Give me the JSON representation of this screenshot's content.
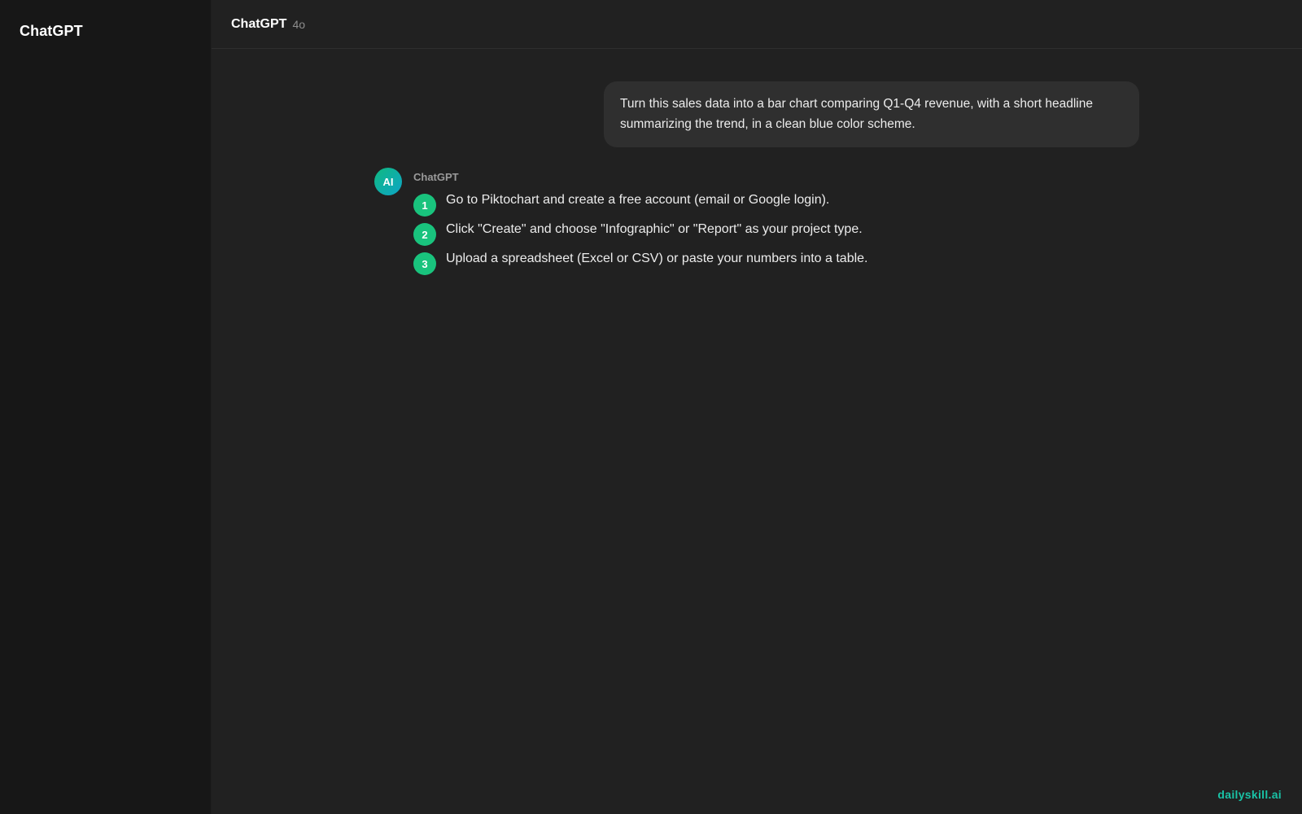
{
  "sidebar": {
    "title": "ChatGPT"
  },
  "header": {
    "title": "ChatGPT",
    "model": "4o"
  },
  "conversation": {
    "user_message": "Turn this sales data into a bar chart comparing Q1-Q4 revenue, with a short headline summarizing the trend, in a clean blue color scheme.",
    "assistant": {
      "avatar_label": "AI",
      "name": "ChatGPT",
      "steps": [
        {
          "number": "1",
          "text": "Go to Piktochart and create a free account (email or Google login)."
        },
        {
          "number": "2",
          "text": "Click \"Create\" and choose \"Infographic\" or \"Report\" as your project type."
        },
        {
          "number": "3",
          "text": "Upload a spreadsheet (Excel or CSV) or paste your numbers into a table."
        }
      ]
    }
  },
  "watermark": "dailyskill.ai",
  "colors": {
    "sidebar_bg": "#171717",
    "main_bg": "#212121",
    "bubble_bg": "#2f2f2f",
    "step_badge": "#19c37d",
    "watermark": "#19c3a6"
  }
}
